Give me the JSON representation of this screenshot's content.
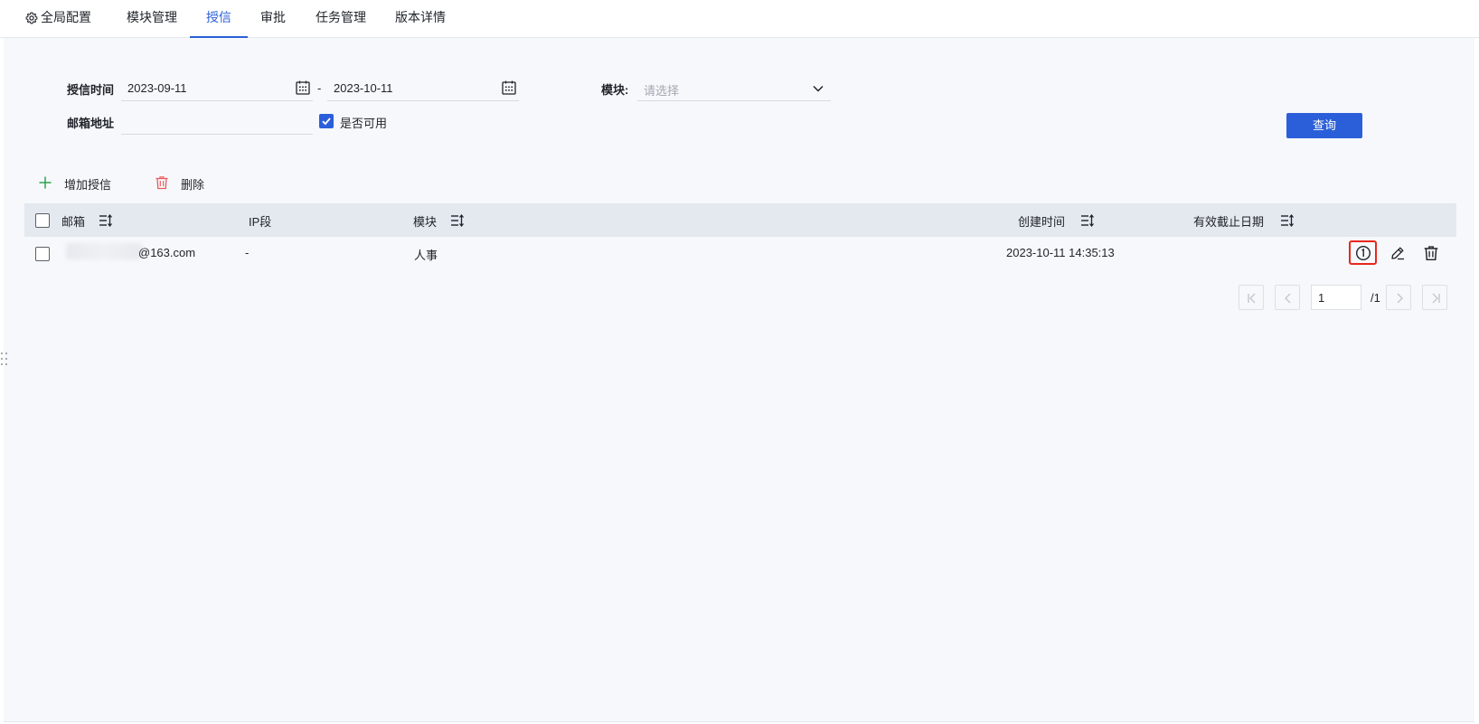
{
  "tabs": {
    "global": "全局配置",
    "modules": "模块管理",
    "credit": "授信",
    "approval": "审批",
    "tasks": "任务管理",
    "version": "版本详情"
  },
  "filters": {
    "credit_time_label": "授信时间",
    "start_date": "2023-09-11",
    "range_sep": "-",
    "end_date": "2023-10-11",
    "module_label": "模块:",
    "module_placeholder": "请选择",
    "email_label": "邮箱地址",
    "email_value": "",
    "available_label": "是否可用",
    "available_checked": true,
    "query_label": "查询"
  },
  "toolbar": {
    "add_label": "增加授信",
    "delete_label": "删除"
  },
  "table": {
    "columns": {
      "email": "邮箱",
      "ip": "IP段",
      "module": "模块",
      "created": "创建时间",
      "expiry": "有效截止日期"
    },
    "rows": [
      {
        "email_suffix": "@163.com",
        "ip": "-",
        "module": "人事",
        "created": "2023-10-11 14:35:13",
        "expiry": ""
      }
    ]
  },
  "pagination": {
    "current_page": "1",
    "total": "/1"
  },
  "colors": {
    "accent": "#2b5fd9",
    "danger": "#e8271d",
    "add_green": "#2ea44f",
    "delete_red": "#e85c5c"
  },
  "icons": [
    "gear-icon",
    "calendar-icon",
    "chevron-down-icon",
    "plus-icon",
    "trash-icon",
    "sort-icon",
    "info-icon",
    "edit-icon",
    "first-page-icon",
    "prev-page-icon",
    "next-page-icon",
    "last-page-icon",
    "drag-handle-icon"
  ]
}
